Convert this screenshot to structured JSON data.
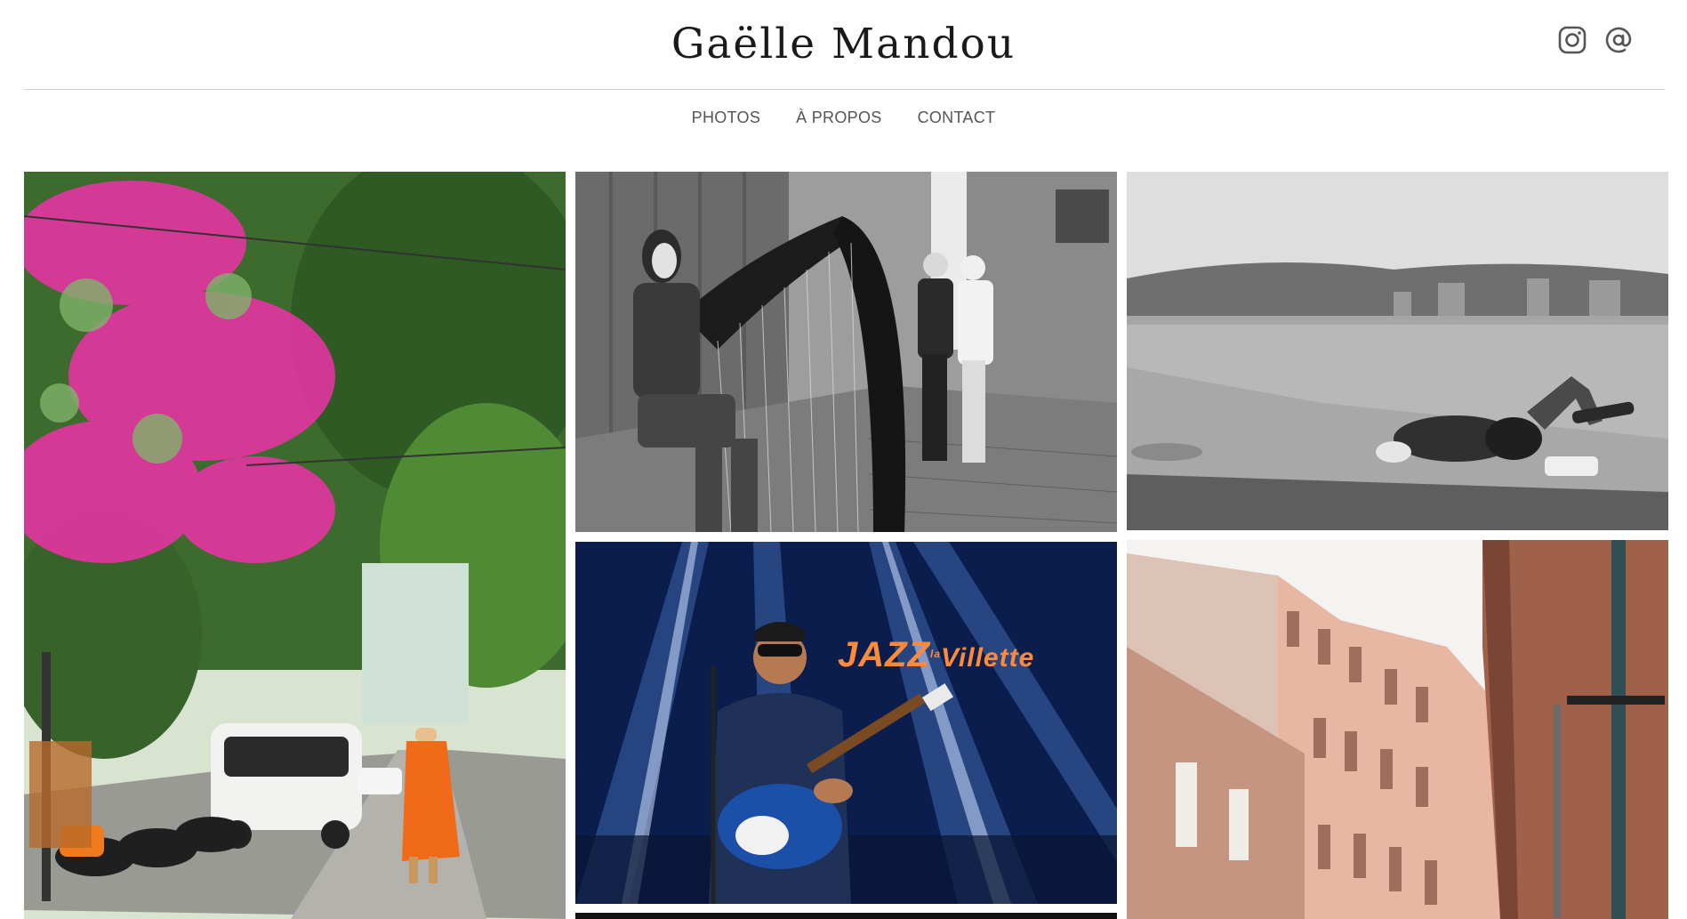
{
  "header": {
    "title": "Gaëlle Mandou",
    "social_icons": [
      "instagram-icon",
      "email-at-icon"
    ]
  },
  "nav": {
    "items": [
      "PHOTOS",
      "À PROPOS",
      "CONTACT"
    ]
  },
  "gallery": {
    "jazz_sign": {
      "word": "JAZZ",
      "small": "la",
      "rest": "Villette"
    }
  },
  "colors": {
    "text": "#1a1a1a",
    "nav": "#555555",
    "divider": "#cfcfcf",
    "stage_blue": "#0f2a6b",
    "robe_orange": "#f06a1a",
    "bougainvillea": "#e0359e",
    "sign_orange": "#ff8a3a"
  }
}
